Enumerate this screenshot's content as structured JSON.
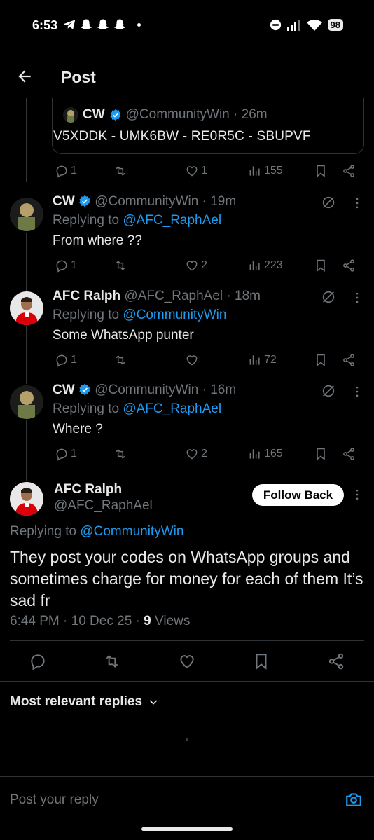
{
  "status_bar": {
    "time": "6:53",
    "battery": "98"
  },
  "header": {
    "title": "Post"
  },
  "quote": {
    "name": "CW",
    "handle": "@CommunityWin · 26m",
    "text": "V5XDDK - UMK6BW - RE0R5C - SBUPVF",
    "replies": "1",
    "likes": "1",
    "views": "155"
  },
  "thread": [
    {
      "name": "CW",
      "handle": "@CommunityWin · 19m",
      "replying_prefix": "Replying to",
      "replying_to": "@AFC_RaphAel",
      "text": "From where ??",
      "replies": "1",
      "likes": "2",
      "views": "223"
    },
    {
      "name": "AFC Ralph",
      "handle": "@AFC_RaphAel · 18m",
      "replying_prefix": "Replying to",
      "replying_to": "@CommunityWin",
      "text": "Some WhatsApp punter",
      "replies": "1",
      "likes": "",
      "views": "72"
    },
    {
      "name": "CW",
      "handle": "@CommunityWin · 16m",
      "replying_prefix": "Replying to",
      "replying_to": "@AFC_RaphAel",
      "text": "Where ?",
      "replies": "1",
      "likes": "2",
      "views": "165"
    }
  ],
  "main_post": {
    "name": "AFC Ralph",
    "handle": "@AFC_RaphAel",
    "follow_label": "Follow Back",
    "replying_prefix": "Replying to",
    "replying_to": "@CommunityWin",
    "text": "They post your codes on WhatsApp groups and sometimes charge for money for each of them It’s sad fr",
    "time": "6:44 PM · 10 Dec 25 ·",
    "views_count": "9",
    "views_label": "Views"
  },
  "replies_section": {
    "sort_label": "Most relevant replies"
  },
  "composer": {
    "placeholder": "Post your reply"
  },
  "colors": {
    "accent": "#1d9bf0",
    "background": "#000000",
    "muted": "#71767b"
  }
}
